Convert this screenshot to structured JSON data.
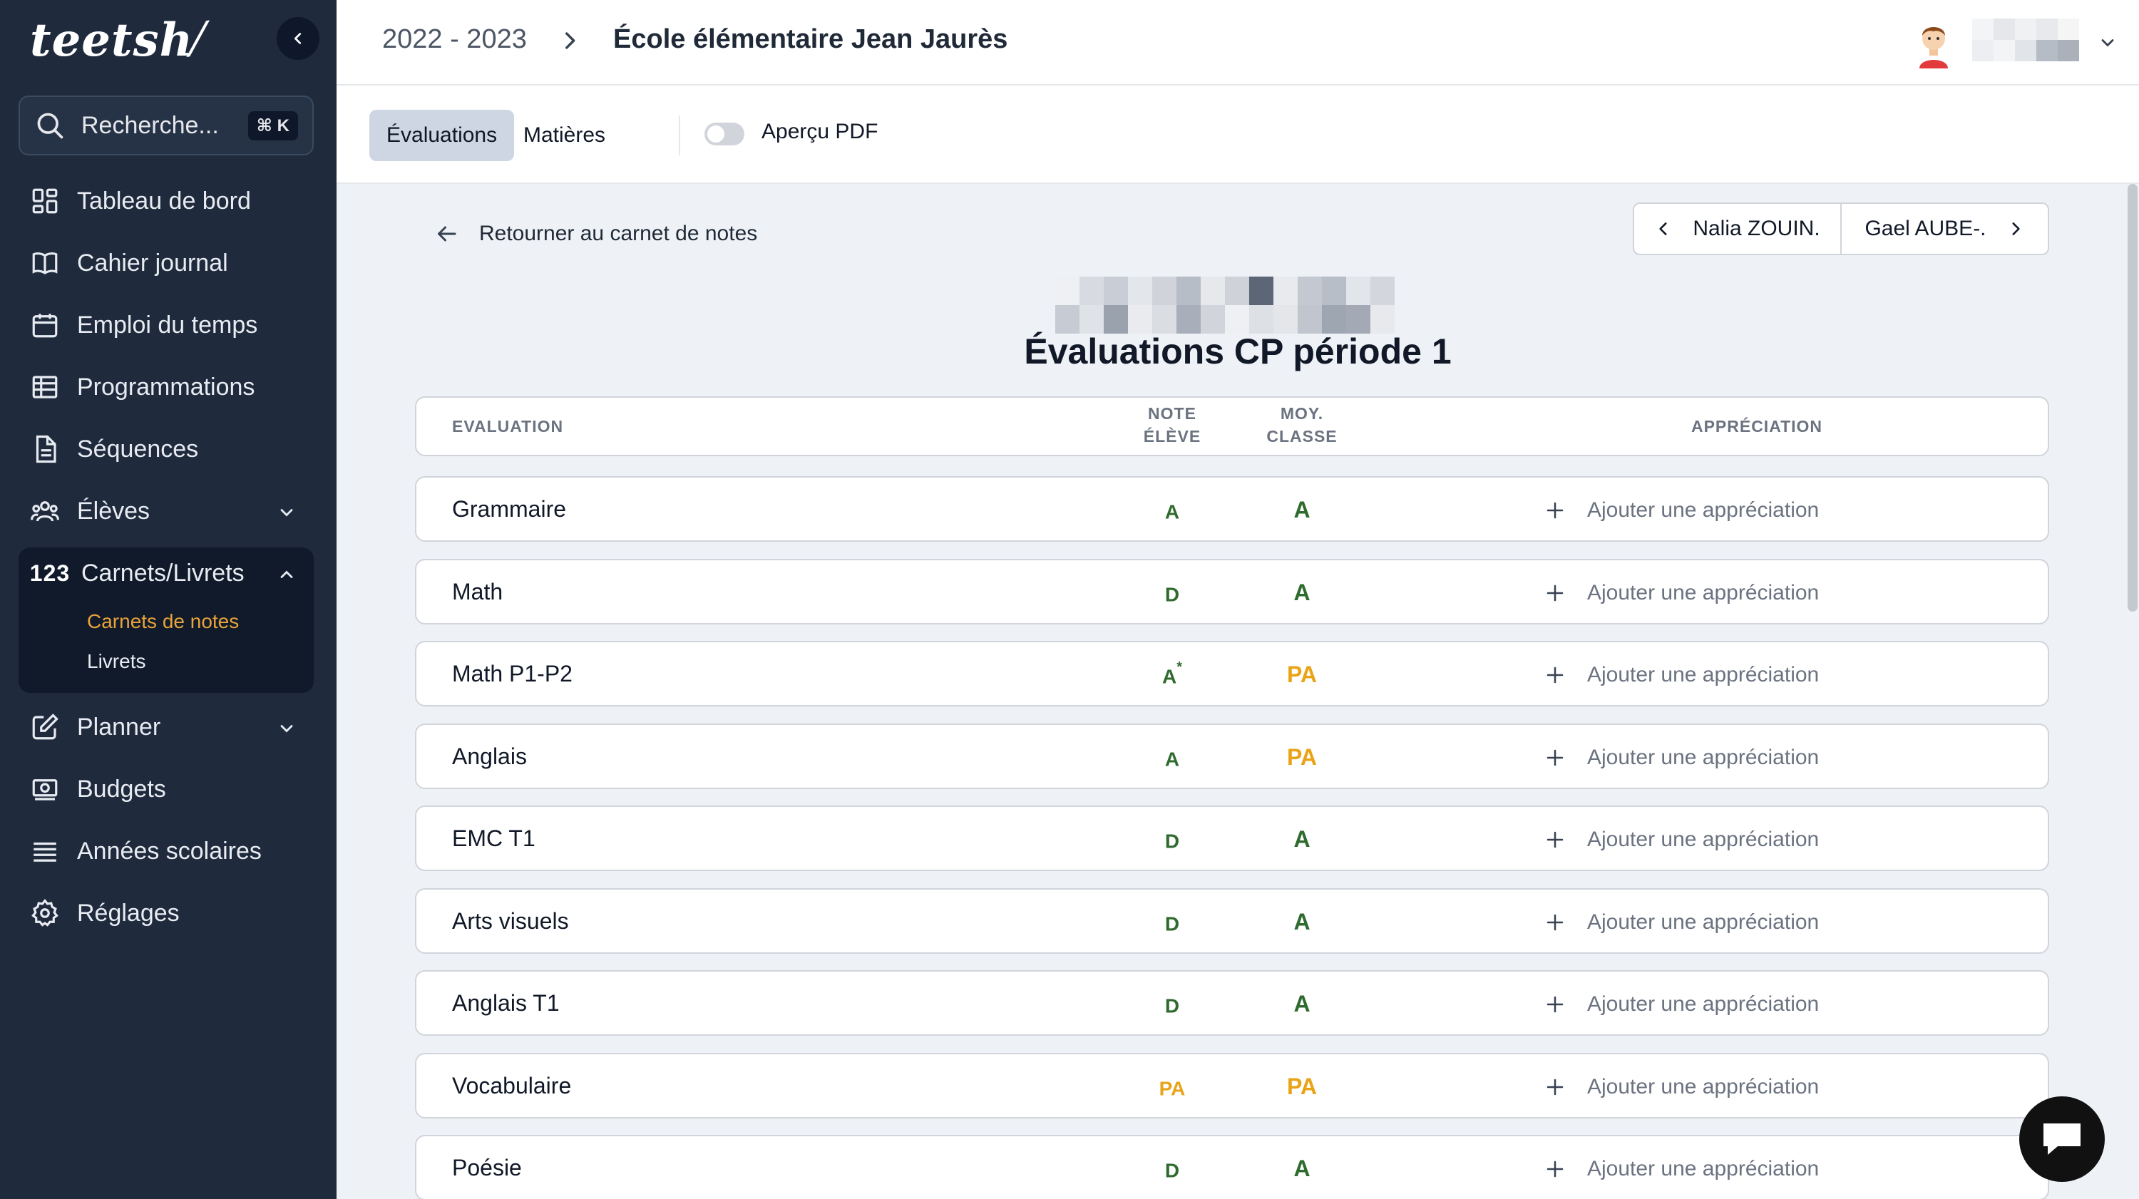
{
  "colors": {
    "sidebar_bg": "#1f2b3d",
    "active_sub": "#e8a33a",
    "grade_green": "#2f6b2f",
    "grade_orange": "#e8a317"
  },
  "sidebar": {
    "logo": "teetsh",
    "search": {
      "placeholder": "Recherche...",
      "shortcut": "⌘ K"
    },
    "items": [
      {
        "label": "Tableau de bord",
        "icon": "dashboard-icon"
      },
      {
        "label": "Cahier journal",
        "icon": "book-icon"
      },
      {
        "label": "Emploi du temps",
        "icon": "calendar-icon"
      },
      {
        "label": "Programmations",
        "icon": "table-icon"
      },
      {
        "label": "Séquences",
        "icon": "document-icon"
      },
      {
        "label": "Élèves",
        "icon": "users-icon"
      },
      {
        "label": "Carnets/Livrets",
        "icon": "numbers-icon",
        "icon_text": "123"
      },
      {
        "label": "Planner",
        "icon": "edit-icon"
      },
      {
        "label": "Budgets",
        "icon": "money-icon"
      },
      {
        "label": "Années scolaires",
        "icon": "list-icon"
      },
      {
        "label": "Réglages",
        "icon": "gear-icon"
      }
    ],
    "subitems": [
      {
        "label": "Carnets de notes",
        "active": true
      },
      {
        "label": "Livrets",
        "active": false
      }
    ]
  },
  "header": {
    "year": "2022 - 2023",
    "school": "École élémentaire Jean Jaurès"
  },
  "tabs": {
    "evaluations": "Évaluations",
    "matieres": "Matières",
    "pdf_preview": "Aperçu PDF"
  },
  "main": {
    "back_label": "Retourner au carnet de notes",
    "prev_student": "Nalia ZOUIN.",
    "next_student": "Gael AUBE-.",
    "title": "Évaluations CP période 1",
    "columns": {
      "evaluation": "EVALUATION",
      "note_line1": "NOTE",
      "note_line2": "ÉLÈVE",
      "moy_line1": "MOY.",
      "moy_line2": "CLASSE",
      "appreciation": "APPRÉCIATION"
    },
    "add_appreciation": "Ajouter une appréciation",
    "rows": [
      {
        "name": "Grammaire",
        "note": "A",
        "note_mark": "",
        "moy": "A"
      },
      {
        "name": "Math",
        "note": "D",
        "note_mark": "",
        "moy": "A"
      },
      {
        "name": "Math P1-P2",
        "note": "A",
        "note_mark": "*",
        "moy": "PA"
      },
      {
        "name": "Anglais",
        "note": "A",
        "note_mark": "",
        "moy": "PA"
      },
      {
        "name": "EMC T1",
        "note": "D",
        "note_mark": "",
        "moy": "A"
      },
      {
        "name": "Arts visuels",
        "note": "D",
        "note_mark": "",
        "moy": "A"
      },
      {
        "name": "Anglais T1",
        "note": "D",
        "note_mark": "",
        "moy": "A"
      },
      {
        "name": "Vocabulaire",
        "note": "PA",
        "note_mark": "",
        "moy": "PA"
      },
      {
        "name": "Poésie",
        "note": "D",
        "note_mark": "",
        "moy": "A"
      }
    ]
  }
}
